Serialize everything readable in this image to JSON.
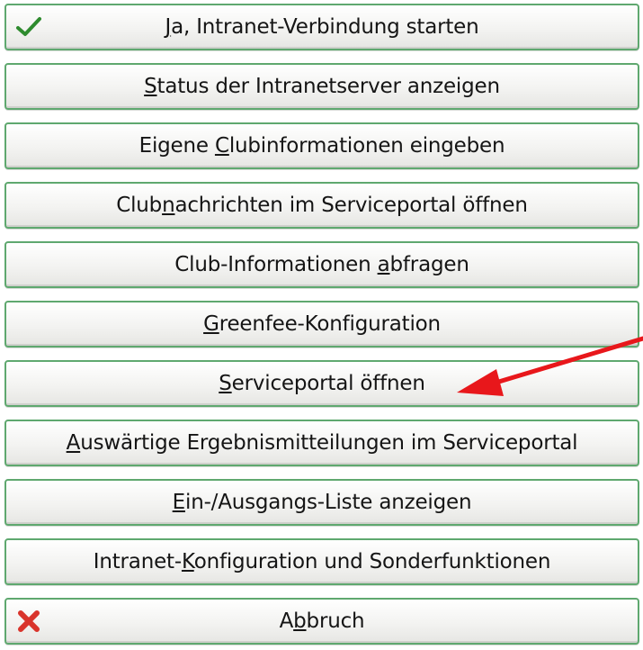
{
  "buttons": [
    {
      "id": "start-intranet",
      "pre": "",
      "u": "J",
      "post": "a, Intranet-Verbindung starten",
      "icon": "check-icon"
    },
    {
      "id": "status-server",
      "pre": "",
      "u": "S",
      "post": "tatus der Intranetserver anzeigen",
      "icon": ""
    },
    {
      "id": "club-info-enter",
      "pre": "Eigene ",
      "u": "C",
      "post": "lubinformationen eingeben",
      "icon": ""
    },
    {
      "id": "club-news",
      "pre": "Club",
      "u": "n",
      "post": "achrichten im Serviceportal öffnen",
      "icon": ""
    },
    {
      "id": "club-info-query",
      "pre": "Club-Informationen ",
      "u": "a",
      "post": "bfragen",
      "icon": ""
    },
    {
      "id": "greenfee-config",
      "pre": "",
      "u": "G",
      "post": "reenfee-Konfiguration",
      "icon": ""
    },
    {
      "id": "serviceportal-open",
      "pre": "",
      "u": "S",
      "post": "erviceportal öffnen",
      "icon": ""
    },
    {
      "id": "external-results",
      "pre": "",
      "u": "A",
      "post": "uswärtige Ergebnismitteilungen im Serviceportal",
      "icon": ""
    },
    {
      "id": "in-out-list",
      "pre": "",
      "u": "E",
      "post": "in-/Ausgangs-Liste anzeigen",
      "icon": ""
    },
    {
      "id": "intranet-config",
      "pre": "Intranet-",
      "u": "K",
      "post": "onfiguration und Sonderfunktionen",
      "icon": ""
    },
    {
      "id": "cancel",
      "pre": "A",
      "u": "b",
      "post": "bruch",
      "icon": "x-icon"
    }
  ],
  "colors": {
    "border": "#5fa86f",
    "check": "#2e8b2e",
    "cancel": "#d9342b",
    "arrow": "#e8171b"
  },
  "annotation": {
    "icon": "red-arrow-icon"
  }
}
